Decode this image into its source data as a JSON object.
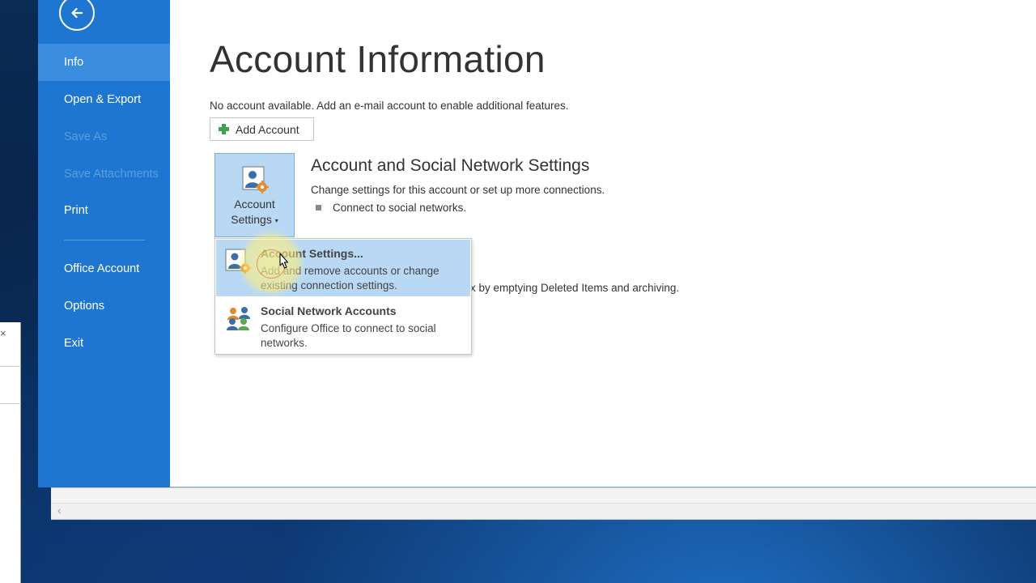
{
  "sidebar": {
    "back_icon": "arrow-left-circle-icon",
    "items": [
      {
        "label": "Info",
        "state": "active"
      },
      {
        "label": "Open & Export",
        "state": "normal"
      },
      {
        "label": "Save As",
        "state": "disabled"
      },
      {
        "label": "Save Attachments",
        "state": "disabled"
      },
      {
        "label": "Print",
        "state": "normal"
      },
      {
        "label": "Office Account",
        "state": "normal"
      },
      {
        "label": "Options",
        "state": "normal"
      },
      {
        "label": "Exit",
        "state": "normal"
      }
    ]
  },
  "main": {
    "title": "Account Information",
    "no_account_text": "No account available. Add an e-mail account to enable additional features.",
    "add_account_label": "Add Account",
    "account_settings_button": {
      "line1": "Account",
      "line2": "Settings",
      "caret": "▾"
    },
    "section": {
      "title": "Account and Social Network Settings",
      "description": "Change settings for this account or set up more connections.",
      "bullet": "Connect to social networks."
    },
    "partial_text": "x by emptying Deleted Items and archiving."
  },
  "dropdown": {
    "items": [
      {
        "title": "Account Settings...",
        "description": "Add and remove accounts or change existing connection settings.",
        "icon": "account-settings-icon",
        "hover": true
      },
      {
        "title": "Social Network Accounts",
        "description": "Configure Office to connect to social networks.",
        "icon": "social-network-icon",
        "hover": false
      }
    ]
  },
  "colors": {
    "sidebar": "#1e76d0",
    "sidebar_active": "#3a8ddf",
    "hover": "#b9d8f3"
  }
}
